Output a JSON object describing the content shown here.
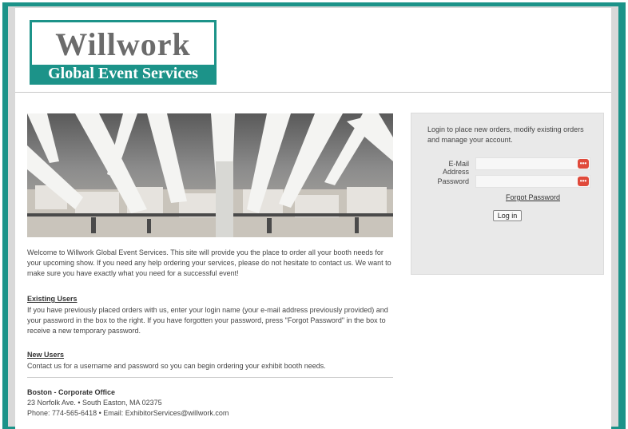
{
  "logo": {
    "brand_top": "Willwork",
    "brand_bottom": "Global Event Services"
  },
  "main": {
    "welcome": "Welcome to Willwork Global Event Services. This site will provide you the place to order all your booth needs for your upcoming show. If you need any help ordering your services, please do not hesitate to contact us. We want to make sure you have exactly what you need for a successful event!",
    "existing_heading": "Existing Users",
    "existing_text": "If you have previously placed orders with us, enter your login name (your e-mail address previously provided) and your password in the box to the right. If you have forgotten your password, press \"Forgot Password\" in the box to receive a new temporary password.",
    "new_heading": "New Users",
    "new_text": "Contact us for a username and password so you can begin ordering your exhibit booth needs.",
    "office_heading": "Boston - Corporate Office",
    "office_address": "23 Norfolk Ave. • South Easton, MA 02375",
    "office_contact": "Phone: 774-565-6418 • Email: ExhibitorServices@willwork.com"
  },
  "login": {
    "intro": "Login to place new orders, modify existing orders and manage your account.",
    "email_label": "E-Mail Address",
    "password_label": "Password",
    "required_badge": "•••",
    "forgot_link": "Forgot Password",
    "login_button": "Log in"
  },
  "colors": {
    "frame": "#1c9389",
    "required": "#e04a3b",
    "panel": "#e9e9e9"
  },
  "icons": {
    "email_required": "required-indicator-icon",
    "password_required": "required-indicator-icon"
  }
}
